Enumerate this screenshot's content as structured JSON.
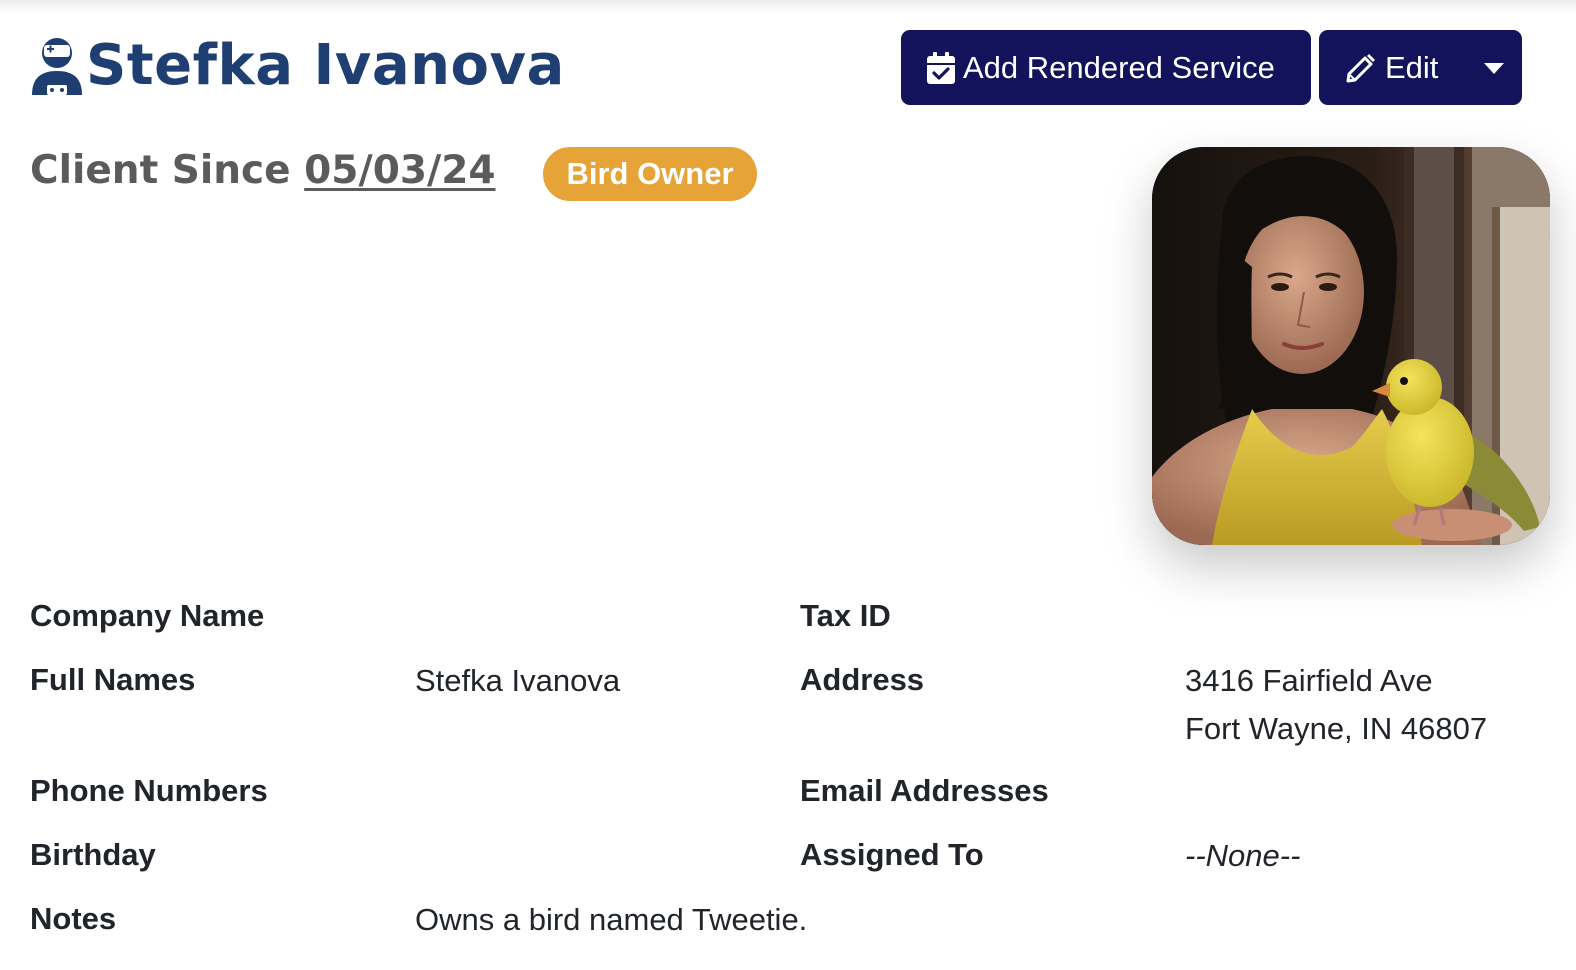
{
  "header": {
    "client_name": "Stefka Ivanova",
    "client_since_label": "Client Since",
    "client_since_date": "05/03/24",
    "tag": "Bird Owner"
  },
  "actions": {
    "add_service_label": "Add Rendered Service",
    "edit_label": "Edit"
  },
  "colors": {
    "title": "#1f3f73",
    "button": "#12135a",
    "badge": "#e6a337",
    "subtitle": "#5b5b5b"
  },
  "photo": {
    "alt": "Stefka Ivanova"
  },
  "details": {
    "company_name_label": "Company Name",
    "company_name": "",
    "tax_id_label": "Tax ID",
    "tax_id": "",
    "full_names_label": "Full Names",
    "full_names": "Stefka Ivanova",
    "address_label": "Address",
    "address_line1": "3416 Fairfield Ave",
    "address_line2": "Fort Wayne, IN 46807",
    "phone_numbers_label": "Phone Numbers",
    "phone_numbers": "",
    "email_addresses_label": "Email Addresses",
    "email_addresses": "",
    "birthday_label": "Birthday",
    "birthday": "",
    "assigned_to_label": "Assigned To",
    "assigned_to": "--None--",
    "notes_label": "Notes",
    "notes": "Owns a bird named Tweetie."
  }
}
